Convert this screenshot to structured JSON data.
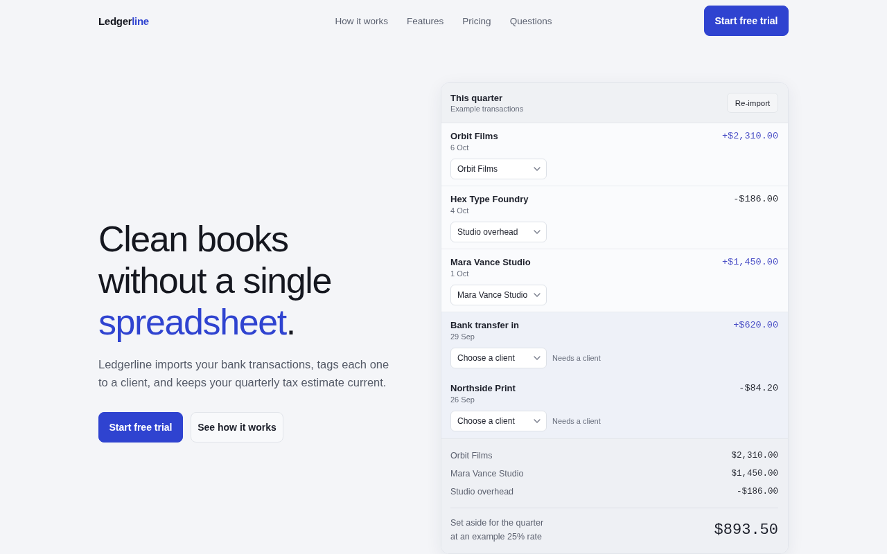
{
  "header": {
    "logo": {
      "text": "Ledger",
      "accent": "line"
    },
    "nav": [
      {
        "label": "How it works"
      },
      {
        "label": "Features"
      },
      {
        "label": "Pricing"
      },
      {
        "label": "Questions"
      }
    ],
    "cta": "Start free trial"
  },
  "hero": {
    "title_lines": [
      "Clean books",
      "without a single"
    ],
    "title_accent": "spreadsheet",
    "title_end": ".",
    "description": "Ledgerline imports your bank transactions, tags each one to a client, and keeps your quarterly tax estimate current.",
    "buttons": [
      {
        "label": "Start free trial",
        "kind": "primary"
      },
      {
        "label": "See how it works",
        "kind": "secondary"
      }
    ]
  },
  "ledger_card": {
    "title": "This quarter",
    "subtitle": "Example transactions",
    "action": "Re-import",
    "transactions": [
      {
        "payee": "Orbit Films",
        "date": "6 Oct",
        "amount": "+$2,310.00",
        "kind": "credit",
        "client": "Orbit Films",
        "needs_client": false
      },
      {
        "payee": "Hex Type Foundry",
        "date": "4 Oct",
        "amount": "-$186.00",
        "kind": "debit",
        "client": "Studio overhead",
        "needs_client": false
      },
      {
        "payee": "Mara Vance Studio",
        "date": "1 Oct",
        "amount": "+$1,450.00",
        "kind": "credit",
        "client": "Mara Vance Studio",
        "needs_client": false
      },
      {
        "payee": "Bank transfer in",
        "date": "29 Sep",
        "amount": "+$620.00",
        "kind": "credit",
        "client": "Choose a client",
        "needs_client": true,
        "note": "Needs a client"
      },
      {
        "payee": "Northside Print",
        "date": "26 Sep",
        "amount": "-$84.20",
        "kind": "debit",
        "client": "Choose a client",
        "needs_client": true,
        "note": "Needs a client"
      }
    ],
    "summary": {
      "lines": [
        {
          "label": "Orbit Films",
          "amount": "$2,310.00"
        },
        {
          "label": "Mara Vance Studio",
          "amount": "$1,450.00"
        },
        {
          "label": "Studio overhead",
          "amount": "-$186.00"
        }
      ],
      "total_label": [
        "Set aside for the quarter",
        "at an example 25% rate"
      ],
      "total": "$893.50"
    }
  }
}
